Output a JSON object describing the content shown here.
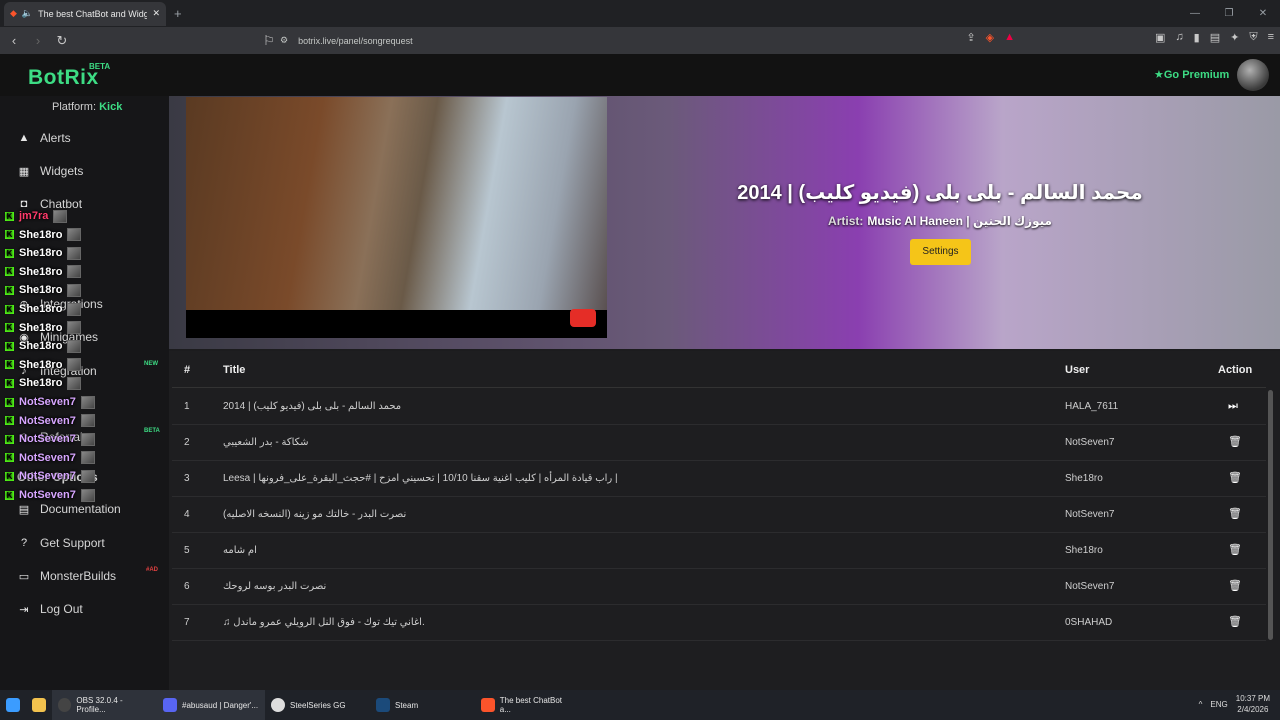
{
  "browser": {
    "tab_title": "The best ChatBot and Widget",
    "new_tab": "+",
    "url": "botrix.live/panel/songrequest"
  },
  "app": {
    "logo": "BotRix",
    "beta": "BETA",
    "go_premium": "Go Premium",
    "platform_label": "Platform:",
    "platform_value": "Kick"
  },
  "sidebar": {
    "items": [
      {
        "label": "Alerts",
        "icon": "warning-icon"
      },
      {
        "label": "Widgets",
        "icon": "grid-icon"
      },
      {
        "label": "Chatbot",
        "icon": "robot-icon"
      },
      {
        "label": "Integrations",
        "icon": "plug-icon"
      },
      {
        "label": "Minigames",
        "icon": "gamepad-icon"
      },
      {
        "label": "Integration",
        "icon": "music-icon"
      },
      {
        "label": "Referrals",
        "icon": "users-icon"
      },
      {
        "label": "Other Options",
        "icon": "dots-icon"
      },
      {
        "label": "Documentation",
        "icon": "book-icon"
      },
      {
        "label": "Get Support",
        "icon": "question-icon"
      },
      {
        "label": "MonsterBuilds",
        "icon": "monitor-icon"
      },
      {
        "label": "Log Out",
        "icon": "logout-icon"
      }
    ],
    "badge_new": "NEW",
    "badge_beta": "BETA",
    "badge_ad": "#AD"
  },
  "chat_overlay": [
    {
      "name": "jm7ra",
      "color": "#ff3b6b"
    },
    {
      "name": "She18ro",
      "color": "#ffffff"
    },
    {
      "name": "She18ro",
      "color": "#ffffff"
    },
    {
      "name": "She18ro",
      "color": "#ffffff"
    },
    {
      "name": "She18ro",
      "color": "#ffffff"
    },
    {
      "name": "She18ro",
      "color": "#ffffff"
    },
    {
      "name": "She18ro",
      "color": "#ffffff"
    },
    {
      "name": "She18ro",
      "color": "#ffffff"
    },
    {
      "name": "She18ro",
      "color": "#ffffff"
    },
    {
      "name": "She18ro",
      "color": "#ffffff"
    },
    {
      "name": "NotSeven7",
      "color": "#d7a6ff"
    },
    {
      "name": "NotSeven7",
      "color": "#d7a6ff"
    },
    {
      "name": "NotSeven7",
      "color": "#d7a6ff"
    },
    {
      "name": "NotSeven7",
      "color": "#d7a6ff"
    },
    {
      "name": "NotSeven7",
      "color": "#d7a6ff"
    },
    {
      "name": "NotSeven7",
      "color": "#d7a6ff"
    }
  ],
  "now_playing": {
    "title": "محمد السالم - بلى بلى (فيديو كليب) | 2014",
    "artist_label": "Artist:",
    "artist": "Music Al Haneen | ميوزك الحنين",
    "settings_button": "Settings"
  },
  "table": {
    "headers": {
      "num": "#",
      "title": "Title",
      "user": "User",
      "action": "Action"
    },
    "rows": [
      {
        "num": "1",
        "title": "محمد السالم - بلى بلى (فيديو كليب) | 2014",
        "user": "HALA_7611",
        "action": "skip"
      },
      {
        "num": "2",
        "title": "شكاكة - بدر الشعيبي",
        "user": "NotSeven7",
        "action": "delete"
      },
      {
        "num": "3",
        "title": "Leesa | راب قيادة المرأه | كليب اغنية سقنا 10/10 | تحسيني امزح | #حجث_البقرة_على_فرونها |",
        "user": "She18ro",
        "action": "delete"
      },
      {
        "num": "4",
        "title": "نصرت البدر - خالتك مو زينه (النسخه الاصليه)",
        "user": "NotSeven7",
        "action": "delete"
      },
      {
        "num": "5",
        "title": "ام شامه",
        "user": "She18ro",
        "action": "delete"
      },
      {
        "num": "6",
        "title": "نصرت البدر بوسه لروحك",
        "user": "NotSeven7",
        "action": "delete"
      },
      {
        "num": "7",
        "title": "♫ اغاني تيك توك - فوق النل الرويلي عمرو ماندل.",
        "user": "0SHAHAD",
        "action": "delete"
      }
    ]
  },
  "taskbar": {
    "items": [
      "OBS 32.0.4 - Profile...",
      "#abusaud | Danger'...",
      "SteelSeries GG",
      "Steam",
      "The best ChatBot a..."
    ],
    "lang": "ENG",
    "time": "10:37 PM",
    "date": "2/4/2026"
  }
}
